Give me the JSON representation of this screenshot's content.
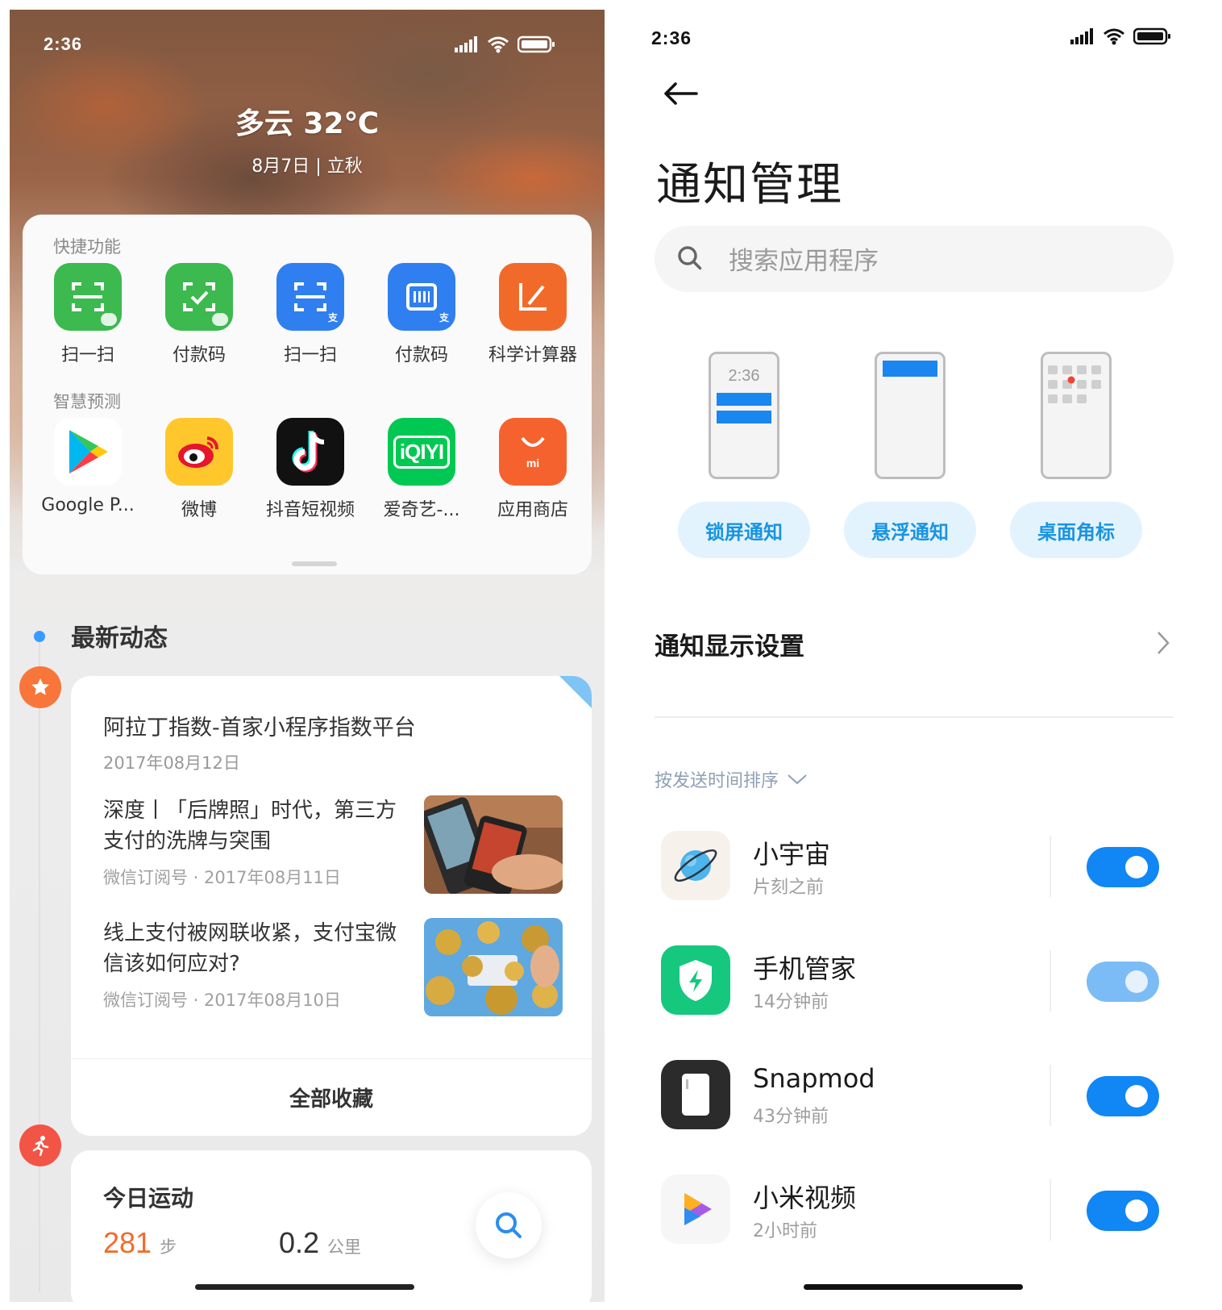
{
  "left": {
    "status_time": "2:36",
    "weather": "多云 32℃",
    "date": "8月7日 | 立秋",
    "quick_label": "快捷功能",
    "quick_apps": [
      {
        "label": "扫一扫",
        "icon": "wechat-scan-icon",
        "color": "#3cb94f"
      },
      {
        "label": "付款码",
        "icon": "wechat-pay-code-icon",
        "color": "#3cb94f"
      },
      {
        "label": "扫一扫",
        "icon": "alipay-scan-icon",
        "color": "#2f7ff0"
      },
      {
        "label": "付款码",
        "icon": "alipay-pay-code-icon",
        "color": "#2f7ff0"
      },
      {
        "label": "科学计算器",
        "icon": "calculator-icon",
        "color": "#f26a2a"
      }
    ],
    "predict_label": "智慧预测",
    "predict_apps": [
      {
        "label": "Google P...",
        "icon": "google-play-icon"
      },
      {
        "label": "微博",
        "icon": "weibo-icon"
      },
      {
        "label": "抖音短视频",
        "icon": "douyin-icon"
      },
      {
        "label": "爱奇艺-...",
        "icon": "iqiyi-icon"
      },
      {
        "label": "应用商店",
        "icon": "app-store-icon"
      }
    ],
    "feed_title": "最新动态",
    "news": {
      "head": "阿拉丁指数-首家小程序指数平台",
      "head_date": "2017年08月12日",
      "items": [
        {
          "title": "深度丨「后牌照」时代，第三方支付的洗牌与突围",
          "meta": "微信订阅号 · 2017年08月11日"
        },
        {
          "title": "线上支付被网联收紧，支付宝微信该如何应对?",
          "meta": "微信订阅号 · 2017年08月10日"
        }
      ],
      "all_label": "全部收藏"
    },
    "sport": {
      "title": "今日运动",
      "steps": "281",
      "steps_unit": "步",
      "distance": "0.2",
      "distance_unit": "公里"
    }
  },
  "right": {
    "status_time": "2:36",
    "title": "通知管理",
    "search_placeholder": "搜索应用程序",
    "mock_time": "2:36",
    "styles": [
      "锁屏通知",
      "悬浮通知",
      "桌面角标"
    ],
    "display_setting": "通知显示设置",
    "sort_label": "按发送时间排序",
    "apps": [
      {
        "name": "小宇宙",
        "time": "片刻之前",
        "enabled": true,
        "icon": "planet-icon"
      },
      {
        "name": "手机管家",
        "time": "14分钟前",
        "enabled": true,
        "dimmed": true,
        "icon": "security-shield-icon"
      },
      {
        "name": "Snapmod",
        "time": "43分钟前",
        "enabled": true,
        "icon": "snapmod-phone-icon"
      },
      {
        "name": "小米视频",
        "time": "2小时前",
        "enabled": true,
        "icon": "mi-video-play-icon"
      }
    ],
    "colors": {
      "toggle_on": "#1186f5",
      "toggle_dim": "#7cbcf6",
      "pill_bg": "#e3f3fd",
      "pill_text": "#1a94e0"
    }
  }
}
